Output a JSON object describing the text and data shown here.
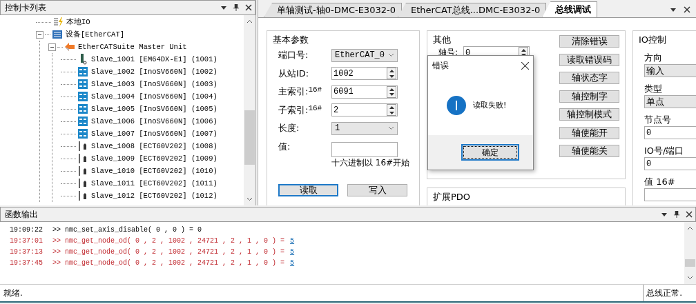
{
  "tree_panel": {
    "title": "控制卡列表",
    "tree": [
      {
        "label": "本地IO",
        "kind": "io"
      },
      {
        "label": "设备[EtherCAT]",
        "kind": "device",
        "expanded": true,
        "children": [
          {
            "label": "EtherCATSuite Master Unit",
            "kind": "master",
            "expanded": true,
            "children": [
              {
                "label": "Slave_1001 [EM64DX-E1] (1001)",
                "kind": "dio"
              },
              {
                "label": "Slave_1002 [InoSV660N] (1002)",
                "kind": "servo"
              },
              {
                "label": "Slave_1003 [InoSV660N] (1003)",
                "kind": "servo"
              },
              {
                "label": "Slave_1004 [InoSV660N] (1004)",
                "kind": "servo"
              },
              {
                "label": "Slave_1005 [InoSV660N] (1005)",
                "kind": "servo"
              },
              {
                "label": "Slave_1006 [InoSV660N] (1006)",
                "kind": "servo"
              },
              {
                "label": "Slave_1007 [InoSV660N] (1007)",
                "kind": "servo"
              },
              {
                "label": "Slave_1008 [ECT60V202] (1008)",
                "kind": "stepper"
              },
              {
                "label": "Slave_1009 [ECT60V202] (1009)",
                "kind": "stepper"
              },
              {
                "label": "Slave_1010 [ECT60V202] (1010)",
                "kind": "stepper"
              },
              {
                "label": "Slave_1011 [ECT60V202] (1011)",
                "kind": "stepper"
              },
              {
                "label": "Slave_1012 [ECT60V202] (1012)",
                "kind": "stepper"
              }
            ]
          }
        ]
      }
    ]
  },
  "tabs": [
    {
      "label": "单轴测试-轴0-DMC-E3032-0",
      "selected": false
    },
    {
      "label": "EtherCAT总线...DMC-E3032-0",
      "selected": false
    },
    {
      "label": "总线调试",
      "selected": true
    }
  ],
  "basic_params": {
    "title": "基本参数",
    "fields": [
      {
        "kind": "select",
        "label": "端口号:",
        "value": "EtherCAT_0"
      },
      {
        "kind": "spin",
        "label": "从站ID:",
        "value": "1002"
      },
      {
        "kind": "spin",
        "label": "主索引:",
        "prefix": "16#",
        "value": "6091"
      },
      {
        "kind": "spin",
        "label": "子索引:",
        "prefix": "16#",
        "value": "2"
      },
      {
        "kind": "select",
        "label": "长度:",
        "value": "1"
      },
      {
        "kind": "text",
        "label": "值:"
      }
    ],
    "hint": "十六进制以 16#开始",
    "buttons": [
      {
        "label": "读取",
        "focused": true
      },
      {
        "label": "写入",
        "focused": false
      }
    ]
  },
  "other": {
    "title": "其他",
    "axis_label": "轴号:",
    "axis_value": "0",
    "buttons": [
      "清除错误",
      "读取错误码",
      "轴状态字",
      "轴控制字",
      "轴控制模式",
      "轴使能开",
      "轴使能关"
    ]
  },
  "io_control": {
    "title": "IO控制",
    "fields": [
      {
        "kind": "select",
        "label": "方向",
        "value": "输入"
      },
      {
        "kind": "select",
        "label": "类型",
        "value": "单点"
      },
      {
        "kind": "text",
        "label": "节点号",
        "value": "0"
      },
      {
        "kind": "text",
        "label": "IO号/端口",
        "value": "0"
      },
      {
        "kind": "text",
        "label": "值 16#"
      }
    ]
  },
  "pdo_group": {
    "title": "扩展PDO"
  },
  "dialog": {
    "title": "错误",
    "message": "读取失败!",
    "button": "确定"
  },
  "output_panel": {
    "title": "函数输出",
    "lines": [
      {
        "time": "19:09:22",
        "text": ">> nmc_set_axis_disable( 0 , 0 ) = 0",
        "error": false
      },
      {
        "time": "19:37:01",
        "text": ">> nmc_get_node_od( 0 , 2 , 1002 , 24721 , 2 , 1 , 0 ) =",
        "result": "5",
        "error": true
      },
      {
        "time": "19:37:13",
        "text": ">> nmc_get_node_od( 0 , 2 , 1002 , 24721 , 2 , 1 , 0 ) =",
        "result": "5",
        "error": true
      },
      {
        "time": "19:37:45",
        "text": ">> nmc_get_node_od( 0 , 2 , 1002 , 24721 , 2 , 1 , 0 ) =",
        "result": "5",
        "error": true
      }
    ]
  },
  "status_bar": {
    "left": "就绪.",
    "right": "总线正常."
  }
}
